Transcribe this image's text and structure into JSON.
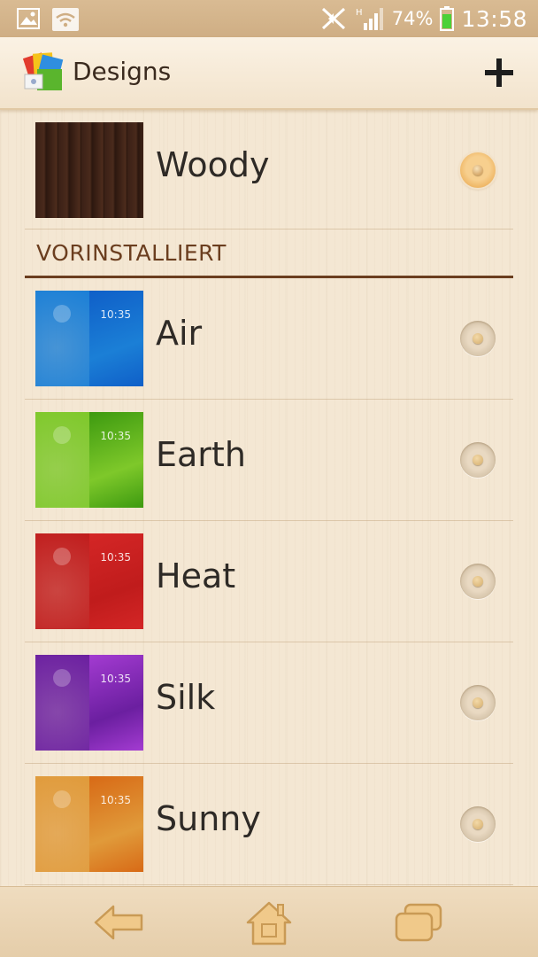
{
  "status_bar": {
    "network_type": "H",
    "battery_percent": "74%",
    "time": "13:58"
  },
  "action_bar": {
    "title": "Designs",
    "add_icon": "plus-icon"
  },
  "current": {
    "label": "Woody",
    "selected": true
  },
  "section": {
    "header": "VORINSTALLIERT"
  },
  "themes": [
    {
      "label": "Air",
      "clock": "10:35",
      "colors": [
        "#1b7fd6",
        "#0f5fc8"
      ]
    },
    {
      "label": "Earth",
      "clock": "10:35",
      "colors": [
        "#7ec82a",
        "#3d9a10"
      ]
    },
    {
      "label": "Heat",
      "clock": "10:35",
      "colors": [
        "#c01c1c",
        "#d42626"
      ]
    },
    {
      "label": "Silk",
      "clock": "10:35",
      "colors": [
        "#6b1fa0",
        "#a33bd1"
      ]
    },
    {
      "label": "Sunny",
      "clock": "10:35",
      "colors": [
        "#e09a3a",
        "#d86a16"
      ]
    }
  ],
  "nav": {
    "back_icon": "back-arrow-icon",
    "home_icon": "home-icon",
    "recent_icon": "recent-apps-icon"
  }
}
